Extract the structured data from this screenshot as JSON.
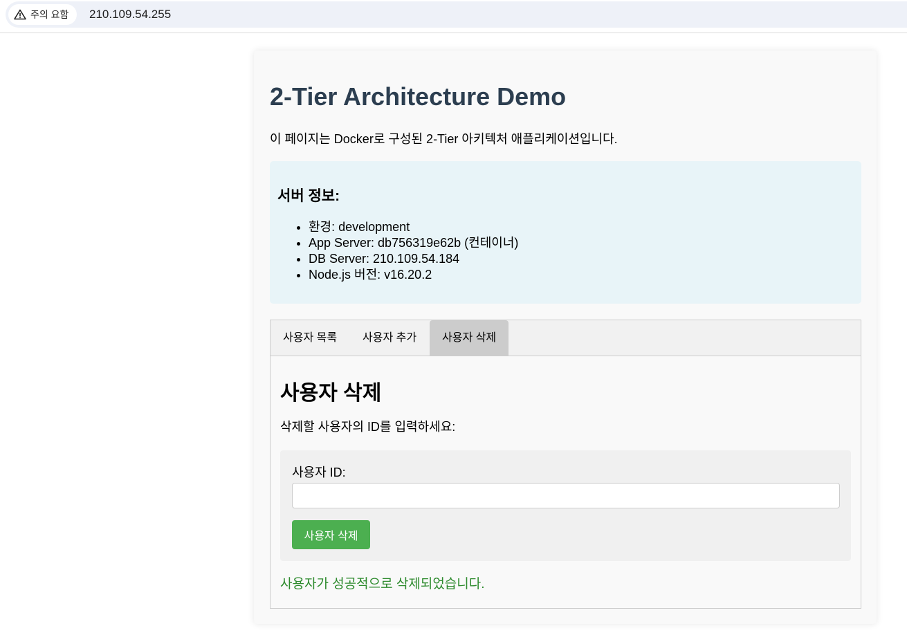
{
  "browser": {
    "security_label": "주의 요함",
    "url": "210.109.54.255"
  },
  "page": {
    "title": "2-Tier Architecture Demo",
    "intro": "이 페이지는 Docker로 구성된 2-Tier 아키텍처 애플리케이션입니다."
  },
  "server_info": {
    "heading": "서버 정보:",
    "items": [
      "환경: development",
      "App Server: db756319e62b (컨테이너)",
      "DB Server: 210.109.54.184",
      "Node.js 버전: v16.20.2"
    ]
  },
  "tabs": [
    {
      "label": "사용자 목록",
      "active": false
    },
    {
      "label": "사용자 추가",
      "active": false
    },
    {
      "label": "사용자 삭제",
      "active": true
    }
  ],
  "delete_panel": {
    "title": "사용자 삭제",
    "description": "삭제할 사용자의 ID를 입력하세요:",
    "field_label": "사용자 ID:",
    "field_value": "",
    "button_label": "사용자 삭제",
    "result_message": "사용자가 성공적으로 삭제되었습니다."
  },
  "colors": {
    "title": "#2c3e50",
    "info_bg": "#e8f4f8",
    "button": "#4caf50",
    "success": "#2e8b2e",
    "active_tab": "#cccccc"
  }
}
